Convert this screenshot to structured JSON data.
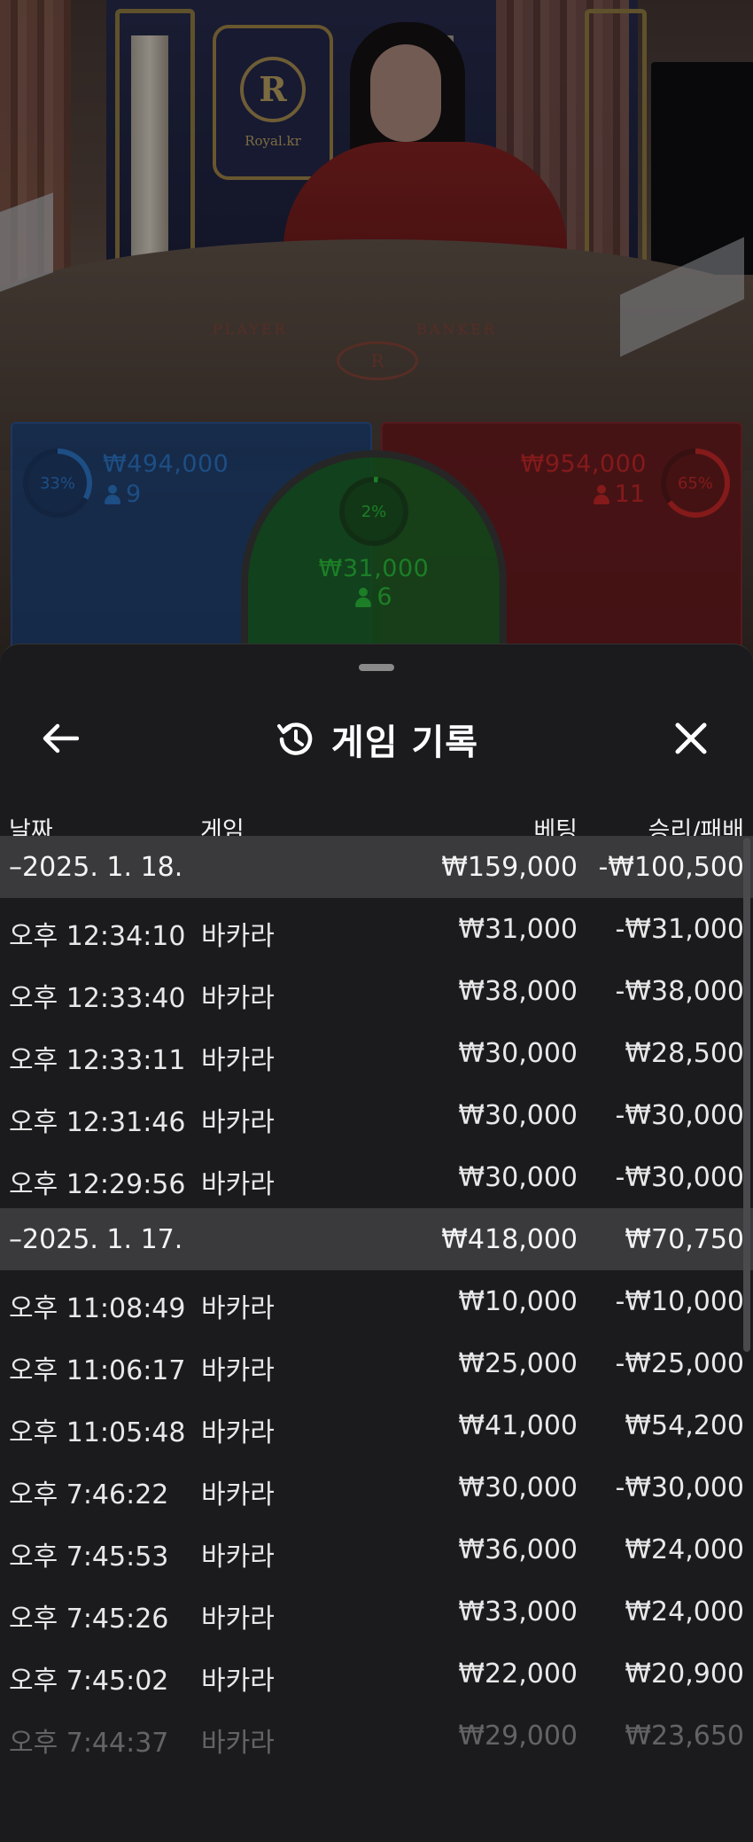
{
  "stream": {
    "logo_letter": "R",
    "logo_site": "Royal.kr",
    "table_player_text": "PLAYER",
    "table_banker_text": "BANKER",
    "table_logo_letter": "R",
    "player": {
      "percent": "33%",
      "amount": "₩494,000",
      "count": "9",
      "color": "#2f7fd6"
    },
    "tie": {
      "percent": "2%",
      "amount": "₩31,000",
      "count": "6",
      "color": "#2ecc40"
    },
    "banker": {
      "percent": "65%",
      "amount": "₩954,000",
      "count": "11",
      "color": "#d62a2a"
    }
  },
  "history": {
    "title": "게임 기록",
    "icons": {
      "back": "arrow-left-icon",
      "history": "history-clock-icon",
      "close": "close-icon"
    },
    "columns": {
      "date": "날짜",
      "game": "게임",
      "bet": "베팅",
      "result": "승리/패배"
    },
    "groups": [
      {
        "date": "–2025. 1. 18.",
        "bet_total": "₩159,000",
        "result_total": "-₩100,500",
        "rows": [
          {
            "time": "오후 12:34:10",
            "game": "바카라",
            "bet": "₩31,000",
            "result": "-₩31,000"
          },
          {
            "time": "오후 12:33:40",
            "game": "바카라",
            "bet": "₩38,000",
            "result": "-₩38,000"
          },
          {
            "time": "오후 12:33:11",
            "game": "바카라",
            "bet": "₩30,000",
            "result": "₩28,500"
          },
          {
            "time": "오후 12:31:46",
            "game": "바카라",
            "bet": "₩30,000",
            "result": "-₩30,000"
          },
          {
            "time": "오후 12:29:56",
            "game": "바카라",
            "bet": "₩30,000",
            "result": "-₩30,000"
          }
        ]
      },
      {
        "date": "–2025. 1. 17.",
        "bet_total": "₩418,000",
        "result_total": "₩70,750",
        "rows": [
          {
            "time": "오후 11:08:49",
            "game": "바카라",
            "bet": "₩10,000",
            "result": "-₩10,000"
          },
          {
            "time": "오후 11:06:17",
            "game": "바카라",
            "bet": "₩25,000",
            "result": "-₩25,000"
          },
          {
            "time": "오후 11:05:48",
            "game": "바카라",
            "bet": "₩41,000",
            "result": "₩54,200"
          },
          {
            "time": "오후 7:46:22",
            "game": "바카라",
            "bet": "₩30,000",
            "result": "-₩30,000"
          },
          {
            "time": "오후 7:45:53",
            "game": "바카라",
            "bet": "₩36,000",
            "result": "₩24,000"
          },
          {
            "time": "오후 7:45:26",
            "game": "바카라",
            "bet": "₩33,000",
            "result": "₩24,000"
          },
          {
            "time": "오후 7:45:02",
            "game": "바카라",
            "bet": "₩22,000",
            "result": "₩20,900"
          },
          {
            "time": "오후 7:44:37",
            "game": "바카라",
            "bet": "₩29,000",
            "result": "₩23,650"
          }
        ]
      }
    ]
  }
}
